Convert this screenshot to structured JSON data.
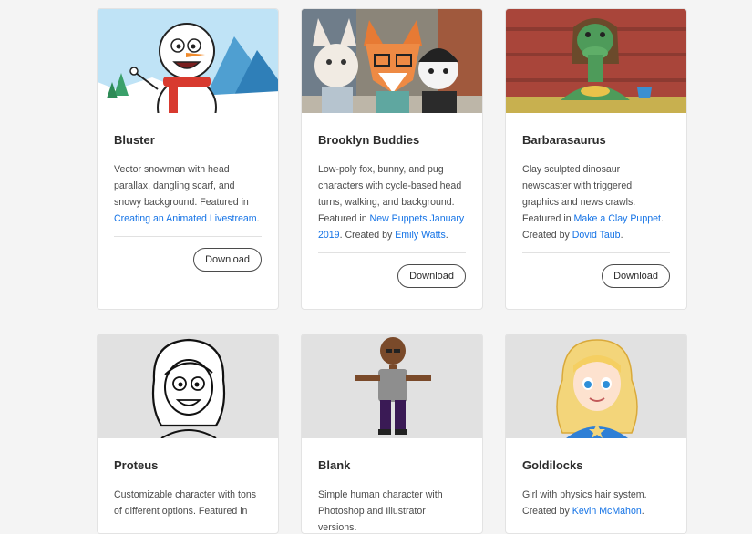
{
  "cards": [
    {
      "title": "Bluster",
      "desc_parts": [
        "Vector snowman with head parallax, dangling scarf, and snowy background. Featured in ",
        "Creating an Animated Livestream",
        "."
      ],
      "button": "Download"
    },
    {
      "title": "Brooklyn Buddies",
      "desc_parts": [
        "Low-poly fox, bunny, and pug characters with cycle-based head turns, walking, and background. Featured in ",
        "New Puppets January 2019",
        ". Created by ",
        "Emily Watts",
        "."
      ],
      "button": "Download"
    },
    {
      "title": "Barbarasaurus",
      "desc_parts": [
        "Clay sculpted dinosaur newscaster with triggered graphics and news crawls. Featured in ",
        "Make a Clay Puppet",
        ". Created by ",
        "Dovid Taub",
        "."
      ],
      "button": "Download"
    },
    {
      "title": "Proteus",
      "desc_parts": [
        "Customizable character with tons of different options. Featured in"
      ]
    },
    {
      "title": "Blank",
      "desc_parts": [
        "Simple human character with Photoshop and Illustrator versions."
      ]
    },
    {
      "title": "Goldilocks",
      "desc_parts": [
        "Girl with physics hair system. Created by ",
        "Kevin McMahon",
        "."
      ]
    }
  ],
  "colors": {
    "link": "#1473e6",
    "page_bg": "#f4f4f4",
    "card_bg": "#ffffff"
  }
}
